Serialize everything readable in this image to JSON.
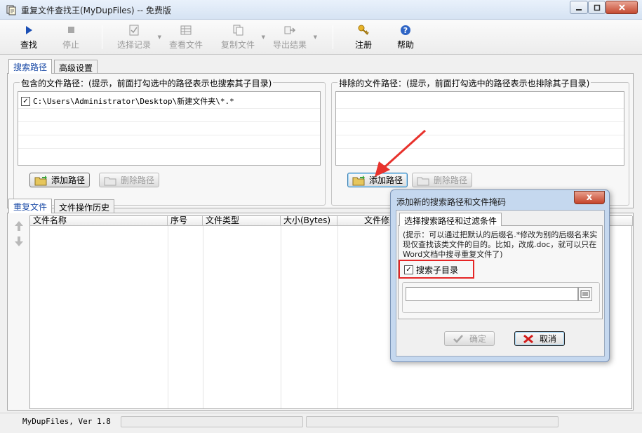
{
  "window": {
    "title": "重复文件查找王(MyDupFiles) -- 免费版"
  },
  "toolbar": {
    "search": "查找",
    "stop": "停止",
    "select_records": "选择记录",
    "view_file": "查看文件",
    "copy_file": "复制文件",
    "export_results": "导出结果",
    "register": "注册",
    "help": "帮助"
  },
  "top_tabs": {
    "search_path": "搜索路径",
    "advanced": "高级设置"
  },
  "include_group": {
    "legend": "包含的文件路径：(提示，前面打勾选中的路径表示也搜索其子目录)",
    "paths": [
      {
        "checked": true,
        "mark": "✓",
        "path": "C:\\Users\\Administrator\\Desktop\\新建文件夹\\*.*"
      }
    ],
    "add_button": "添加路径",
    "remove_button": "删除路径"
  },
  "exclude_group": {
    "legend": "排除的文件路径：(提示，前面打勾选中的路径表示也排除其子目录)",
    "add_button": "添加路径",
    "remove_button": "删除路径"
  },
  "bottom_tabs": {
    "duplicates": "重复文件",
    "history": "文件操作历史"
  },
  "grid": {
    "columns": [
      "文件名称",
      "序号",
      "文件类型",
      "大小(Bytes)",
      "文件修"
    ]
  },
  "status": {
    "version": "MyDupFiles, Ver 1.8"
  },
  "dialog": {
    "title": "添加新的搜索路径和文件掩码",
    "close_label": "x",
    "tab": "选择搜索路径和过滤条件",
    "hint": "(提示：可以通过把默认的后缀名.*修改为别的后缀名来实现仅查找该类文件的目的。比如，改成.doc，就可以只在Word文档中搜寻重复文件了)",
    "path_value": "",
    "subdir_checkbox": {
      "label": "搜索子目录",
      "checked": true,
      "mark": "✓"
    },
    "ok_button": "确定",
    "cancel_button": "取消"
  },
  "colors": {
    "accent_tab": "#1f4ea8",
    "highlight_box": "#e52525",
    "arrow": "#e8322c"
  }
}
